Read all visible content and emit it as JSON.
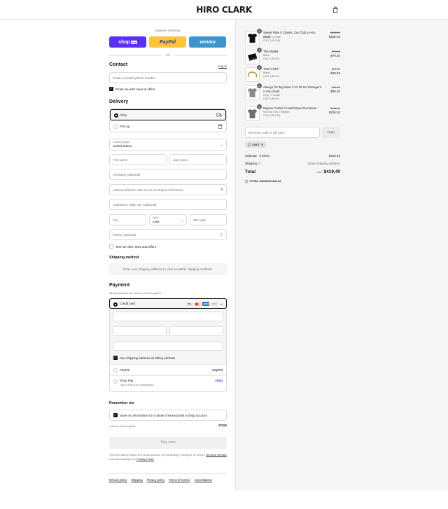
{
  "header": {
    "brand": "HIRO CLARK",
    "cart_icon": "shopping-bag-icon"
  },
  "express": {
    "label": "Express checkout",
    "shop_pay": "shop",
    "shop_pay_suffix": "Pay",
    "paypal": "PayPal",
    "venmo": "venmo",
    "or": "OR"
  },
  "contact": {
    "heading": "Contact",
    "login": "Log in",
    "email_placeholder": "Email or mobile phone number",
    "news_label": "Email me with news & offers",
    "news_checked": true
  },
  "delivery": {
    "heading": "Delivery",
    "options": [
      {
        "label": "Ship",
        "icon": "truck-icon",
        "selected": true
      },
      {
        "label": "Pick up",
        "icon": "store-icon",
        "selected": false
      }
    ],
    "country_label": "Country/Region",
    "country_value": "United States",
    "first_name": "First name",
    "last_name": "Last name",
    "company": "Company (optional)",
    "address": "Address (Please note we do not ship to PO boxes)",
    "apartment": "Apartment, suite, etc. (optional)",
    "city": "City",
    "state_label": "State",
    "state_value": "Iowa",
    "zip": "ZIP code",
    "phone": "Phone (optional)",
    "text_label": "Text me with news and offers"
  },
  "shipping_method": {
    "heading": "Shipping method",
    "message": "Enter your shipping address to view available shipping methods."
  },
  "payment": {
    "heading": "Payment",
    "subtitle": "All transactions are secure and encrypted.",
    "credit_card": "Credit card",
    "card_logos": [
      "VISA",
      "MC",
      "AMEX",
      "DISC"
    ],
    "more_cards": "+4",
    "billing_label": "Use shipping address as billing address",
    "paypal": "PayPal",
    "paypal_brand": "PayPal",
    "shop_pay": "Shop Pay",
    "shop_pay_sub": "Pay in full or in installments",
    "shop_pay_brand": "shop"
  },
  "remember": {
    "heading": "Remember me",
    "label": "Save my information for a faster checkout with a Shop account",
    "secure": "Secure and encrypted",
    "shop_mark": "shop"
  },
  "pay_now": "Pay now",
  "legal": {
    "before": "Your info will be saved to a Shop account. By continuing, you agree to Shop's",
    "terms": "Terms of Service",
    "middle": "and acknowledge the",
    "privacy": "Privacy Policy"
  },
  "footer": [
    "Refund policy",
    "Shipping",
    "Privacy policy",
    "Terms of service",
    "Cancellations"
  ],
  "cart": {
    "items": [
      {
        "qty": "1",
        "name": "Sweet Ride // Classic Car Club x Hiro Clark",
        "variant": "Black / X-Small",
        "discount": "CULT (-$11.80)",
        "old_price": "$118.00",
        "price": "$106.20",
        "thumb": "black-tshirt"
      },
      {
        "qty": "1",
        "name": "The Wallet",
        "variant": "Black",
        "discount": "CULT (-$7.80)",
        "old_price": "$78.00",
        "price": "$70.20",
        "thumb": "black-wallet"
      },
      {
        "qty": "1",
        "name": "THE CUFF",
        "variant": "Brass",
        "discount": "CULT (-$5.40)",
        "old_price": "$54.00",
        "price": "$48.60",
        "thumb": "brass-cuff"
      },
      {
        "qty": "1",
        "name": "Always On My Mind // All Of Us Strangers x Hiro Clark",
        "variant": "Grey / X-Small",
        "discount": "CULT (-$9.80)",
        "old_price": "$98.00",
        "price": "$88.20",
        "thumb": "grey-tshirt"
      },
      {
        "qty": "1",
        "name": "Mojave T-shirt // Hand-Dyed Exclusive",
        "variant": "Morning Grey / Medium",
        "discount": "CULT (-$11.80)",
        "old_price": "$118.00",
        "price": "$106.20",
        "thumb": "grey-tshirt-2"
      }
    ],
    "code_placeholder": "Discount code or gift card",
    "apply": "Apply",
    "chip": "CULT",
    "subtotal_label": "Subtotal · 5 items",
    "subtotal_value": "$419.40",
    "shipping_label": "Shipping",
    "shipping_value": "Enter shipping address",
    "total_label": "Total",
    "total_currency": "USD",
    "total_value": "$419.40",
    "savings": "TOTAL SAVINGS  $46.60"
  }
}
